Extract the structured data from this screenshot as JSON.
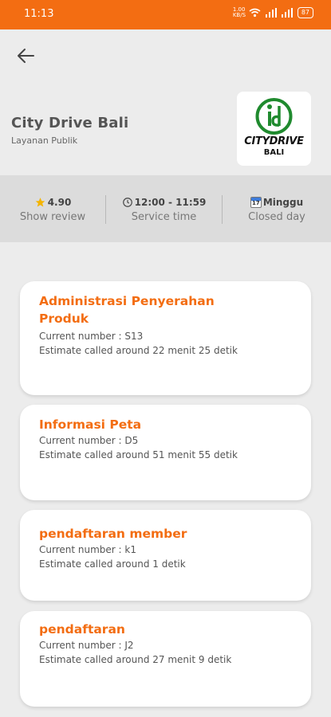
{
  "status_bar": {
    "time": "11:13",
    "network": "1.00 KB/S",
    "battery": "87"
  },
  "header": {
    "title": "City Drive Bali",
    "subtitle": "Layanan Publik",
    "logo": {
      "brand": "CITYDRIVE",
      "sub": "BALI",
      "color": "#1f8a2e"
    }
  },
  "stats": [
    {
      "icon": "star-icon",
      "value": "4.90",
      "label": "Show review"
    },
    {
      "icon": "clock-icon",
      "value": "12:00 - 11:59",
      "label": "Service time"
    },
    {
      "icon": "calendar-icon",
      "calendar_day": "17",
      "value": "Minggu",
      "label": "Closed day"
    }
  ],
  "services": [
    {
      "name": "Administrasi Penyerahan Produk",
      "current": "Current number : S13",
      "estimate": "Estimate called around 22 menit 25 detik"
    },
    {
      "name": "Informasi Peta",
      "current": "Current number : D5",
      "estimate": "Estimate called around 51 menit 55 detik"
    },
    {
      "name": "pendaftaran member",
      "current": "Current number : k1",
      "estimate": "Estimate called around 1 detik"
    },
    {
      "name": "pendaftaran",
      "current": "Current number : J2",
      "estimate": "Estimate called around 27 menit 9 detik"
    }
  ],
  "colors": {
    "accent": "#f36d12",
    "background": "#ececec"
  }
}
